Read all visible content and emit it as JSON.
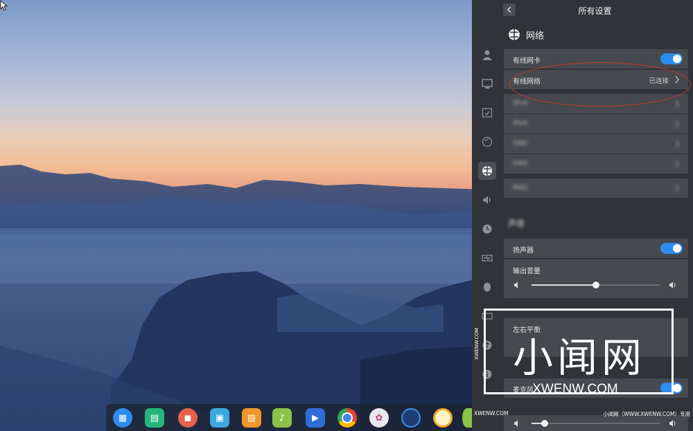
{
  "panel": {
    "title": "所有设置",
    "section_title": "网络",
    "wired_card_label": "有线网卡",
    "wired_network_label": "有线网络",
    "wired_network_status": "已连接",
    "blurred_rows": [
      "IPv4",
      "IPv6",
      "DNS",
      "DNS",
      "MAC"
    ],
    "sound_section": "声音",
    "speaker_label": "扬声器",
    "output_volume_label": "输出音量",
    "output_volume_level": 0.5,
    "balance_label": "左右平衡",
    "mic_label": "麦克风",
    "input_volume_level": 0.1
  },
  "sidebar": {
    "items": [
      "user-icon",
      "display-icon",
      "calendar-icon",
      "theme-icon",
      "network-icon",
      "sound-icon",
      "time-icon",
      "power-icon",
      "mouse-icon",
      "keyboard-icon",
      "update-icon",
      "info-icon"
    ],
    "active": "network-icon"
  },
  "dock": {
    "apps": [
      "launcher",
      "files",
      "screenshot",
      "store",
      "app-store",
      "music",
      "video",
      "chrome",
      "settings",
      "monitor",
      "browser",
      "more"
    ]
  },
  "watermark": {
    "big": "小闻网",
    "domain": "XWENW.COM",
    "footer_left": "XWENW.COM",
    "footer_right": "小闻网（WWW.XWENW.COM）专用",
    "vertical": "XWENW.COM"
  },
  "colors": {
    "panel_bg": "#303338",
    "row_bg": "#46494e",
    "toggle_on": "#2d8cf0",
    "oval": "#c0392b"
  }
}
